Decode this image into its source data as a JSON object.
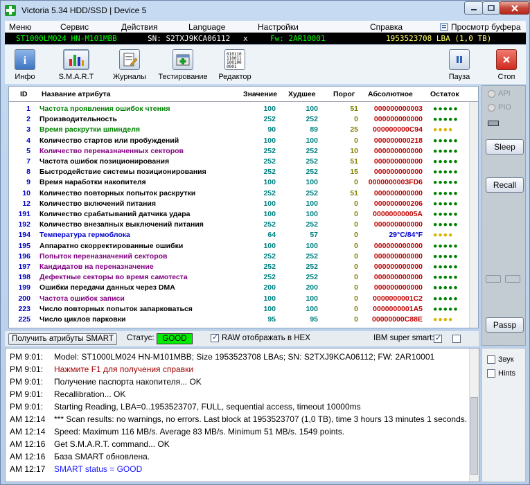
{
  "window": {
    "title": "Victoria 5.34 HDD/SSD | Device 5"
  },
  "menu": [
    "Меню",
    "Сервис",
    "Действия",
    "Language",
    "Настройки",
    "Справка",
    "Просмотр буфера"
  ],
  "device": {
    "model": "ST1000LM024 HN-M101MBB",
    "serial": "SN: S2TXJ9KCA06112",
    "close": "x",
    "firmware": "Fw: 2AR10001",
    "lba": "1953523708 LBA (1,0 TB)"
  },
  "toolbar": {
    "info": "Инфо",
    "smart": "S.M.A.R.T",
    "logs": "Журналы",
    "test": "Тестирование",
    "editor": "Редактор",
    "pause": "Пауза",
    "stop": "Стоп"
  },
  "colors": {
    "green": "#008000",
    "navy": "#000080",
    "purple": "#800080",
    "olive": "#808000",
    "blue": "#0000cc",
    "teal": "#008080",
    "red": "#c00000",
    "yellow": "#d9b400",
    "ok_green": "#00cc00"
  },
  "table": {
    "headers": {
      "id": "ID",
      "name": "Название атрибута",
      "value": "Значение",
      "worst": "Худшее",
      "threshold": "Порог",
      "raw": "Абсолютное",
      "rest": "Остаток"
    },
    "rows": [
      {
        "id": "1",
        "name": "Частота проявления ошибок чтения",
        "value": "100",
        "worst": "100",
        "threshold": "51",
        "raw": "000000000003",
        "rest": "●●●●●",
        "nc": "#008000",
        "tc": "#808000",
        "rc": "#008000"
      },
      {
        "id": "2",
        "name": "Производительность",
        "value": "252",
        "worst": "252",
        "threshold": "0",
        "raw": "000000000000",
        "rest": "●●●●●",
        "nc": "#000000",
        "tc": "#808000",
        "rc": "#008000"
      },
      {
        "id": "3",
        "name": "Время раскрутки шпинделя",
        "value": "90",
        "worst": "89",
        "threshold": "25",
        "raw": "000000000C94",
        "rest": "●●●●",
        "nc": "#008000",
        "tc": "#808000",
        "rc": "#d9b400"
      },
      {
        "id": "4",
        "name": "Количество стартов или пробуждений",
        "value": "100",
        "worst": "100",
        "threshold": "0",
        "raw": "000000000218",
        "rest": "●●●●●",
        "nc": "#000000",
        "tc": "#808000",
        "rc": "#008000"
      },
      {
        "id": "5",
        "name": "Количество переназначенных секторов",
        "value": "252",
        "worst": "252",
        "threshold": "10",
        "raw": "000000000000",
        "rest": "●●●●●",
        "nc": "#800080",
        "tc": "#808000",
        "rc": "#008000"
      },
      {
        "id": "7",
        "name": "Частота ошибок позиционирования",
        "value": "252",
        "worst": "252",
        "threshold": "51",
        "raw": "000000000000",
        "rest": "●●●●●",
        "nc": "#000000",
        "tc": "#808000",
        "rc": "#008000"
      },
      {
        "id": "8",
        "name": "Быстродействие системы позиционирования",
        "value": "252",
        "worst": "252",
        "threshold": "15",
        "raw": "000000000000",
        "rest": "●●●●●",
        "nc": "#000000",
        "tc": "#808000",
        "rc": "#008000"
      },
      {
        "id": "9",
        "name": "Время наработки накопителя",
        "value": "100",
        "worst": "100",
        "threshold": "0",
        "raw": "0000000003FD6",
        "rest": "●●●●●",
        "nc": "#000000",
        "tc": "#808000",
        "rc": "#008000"
      },
      {
        "id": "10",
        "name": "Количество повторных попыток раскрутки",
        "value": "252",
        "worst": "252",
        "threshold": "51",
        "raw": "000000000000",
        "rest": "●●●●●",
        "nc": "#000000",
        "tc": "#808000",
        "rc": "#008000"
      },
      {
        "id": "12",
        "name": "Количество включений питания",
        "value": "100",
        "worst": "100",
        "threshold": "0",
        "raw": "000000000206",
        "rest": "●●●●●",
        "nc": "#000000",
        "tc": "#808000",
        "rc": "#008000"
      },
      {
        "id": "191",
        "name": "Количество срабатываний датчика удара",
        "value": "100",
        "worst": "100",
        "threshold": "0",
        "raw": "00000000005A",
        "rest": "●●●●●",
        "nc": "#000000",
        "tc": "#808000",
        "rc": "#008000"
      },
      {
        "id": "192",
        "name": "Количество внезапных выключений питания",
        "value": "252",
        "worst": "252",
        "threshold": "0",
        "raw": "000000000000",
        "rest": "●●●●●",
        "nc": "#000000",
        "tc": "#808000",
        "rc": "#008000"
      },
      {
        "id": "194",
        "name": "Температура гермоблока",
        "value": "64",
        "worst": "57",
        "threshold": "0",
        "raw": "29°C/84°F",
        "rest": "●●●●",
        "nc": "#0000cc",
        "tc": "#808000",
        "rc": "#d9b400",
        "rawc": "#0000cc"
      },
      {
        "id": "195",
        "name": "Аппаратно скорректированные ошибки",
        "value": "100",
        "worst": "100",
        "threshold": "0",
        "raw": "000000000000",
        "rest": "●●●●●",
        "nc": "#000000",
        "tc": "#808000",
        "rc": "#008000"
      },
      {
        "id": "196",
        "name": "Попыток переназначений секторов",
        "value": "252",
        "worst": "252",
        "threshold": "0",
        "raw": "000000000000",
        "rest": "●●●●●",
        "nc": "#800080",
        "tc": "#808000",
        "rc": "#008000"
      },
      {
        "id": "197",
        "name": "Кандидатов на переназначение",
        "value": "252",
        "worst": "252",
        "threshold": "0",
        "raw": "000000000000",
        "rest": "●●●●●",
        "nc": "#800080",
        "tc": "#808000",
        "rc": "#008000"
      },
      {
        "id": "198",
        "name": "Дефектные секторы во время самотеста",
        "value": "252",
        "worst": "252",
        "threshold": "0",
        "raw": "000000000000",
        "rest": "●●●●●",
        "nc": "#800080",
        "tc": "#808000",
        "rc": "#008000"
      },
      {
        "id": "199",
        "name": "Ошибки передачи данных через DMA",
        "value": "200",
        "worst": "200",
        "threshold": "0",
        "raw": "000000000000",
        "rest": "●●●●●",
        "nc": "#000000",
        "tc": "#808000",
        "rc": "#008000"
      },
      {
        "id": "200",
        "name": "Частота ошибок записи",
        "value": "100",
        "worst": "100",
        "threshold": "0",
        "raw": "0000000001C2",
        "rest": "●●●●●",
        "nc": "#800080",
        "tc": "#808000",
        "rc": "#008000"
      },
      {
        "id": "223",
        "name": "Число повторных попыток запарковаться",
        "value": "100",
        "worst": "100",
        "threshold": "0",
        "raw": "0000000001A5",
        "rest": "●●●●●",
        "nc": "#000000",
        "tc": "#808000",
        "rc": "#008000"
      },
      {
        "id": "225",
        "name": "Число циклов парковки",
        "value": "95",
        "worst": "95",
        "threshold": "0",
        "raw": "00000000C88E",
        "rest": "●●●●",
        "nc": "#000000",
        "tc": "#808000",
        "rc": "#d9b400"
      }
    ]
  },
  "right_panel": {
    "api": "API",
    "pio": "PIO",
    "sleep": "Sleep",
    "recall": "Recall",
    "wr": "WR",
    "rd": "RD",
    "passp": "Passp"
  },
  "status_row": {
    "get_button": "Получить атрибуты SMART",
    "status_label": "Статус:",
    "status_value": "GOOD",
    "raw_hex": "RAW отображать в HEX",
    "ibm": "IBM super smart:"
  },
  "log": [
    {
      "time": "PM 9:01:",
      "text": "Model: ST1000LM024 HN-M101MBB; Size 1953523708 LBAs; SN: S2TXJ9KCA06112; FW: 2AR10001",
      "color": "#000000"
    },
    {
      "time": "PM 9:01:",
      "text": "Нажмите F1 для получения справки",
      "color": "#a00000"
    },
    {
      "time": "PM 9:01:",
      "text": "Получение паспорта накопителя... OK",
      "color": "#000000"
    },
    {
      "time": "PM 9:01:",
      "text": "Recallibration... OK",
      "color": "#000000"
    },
    {
      "time": "PM 9:01:",
      "text": "Starting Reading, LBA=0..1953523707, FULL, sequential access, timeout 10000ms",
      "color": "#000000"
    },
    {
      "time": "AM 12:14",
      "text": "*** Scan results: no warnings, no errors. Last block at 1953523707 (1,0 TB), time 3 hours 13 minutes 1 seconds.",
      "color": "#000000"
    },
    {
      "time": "AM 12:14",
      "text": "Speed: Maximum 116 MB/s. Average 83 MB/s. Minimum 51 MB/s. 1549 points.",
      "color": "#000000"
    },
    {
      "time": "AM 12:16",
      "text": "Get S.M.A.R.T. command... OK",
      "color": "#000000"
    },
    {
      "time": "AM 12:16",
      "text": "База SMART обновлена.",
      "color": "#000000"
    },
    {
      "time": "AM 12:17",
      "text": "SMART status = GOOD",
      "color": "#1a1aff"
    }
  ],
  "log_side": {
    "sound": "Звук",
    "hints": "Hints"
  }
}
